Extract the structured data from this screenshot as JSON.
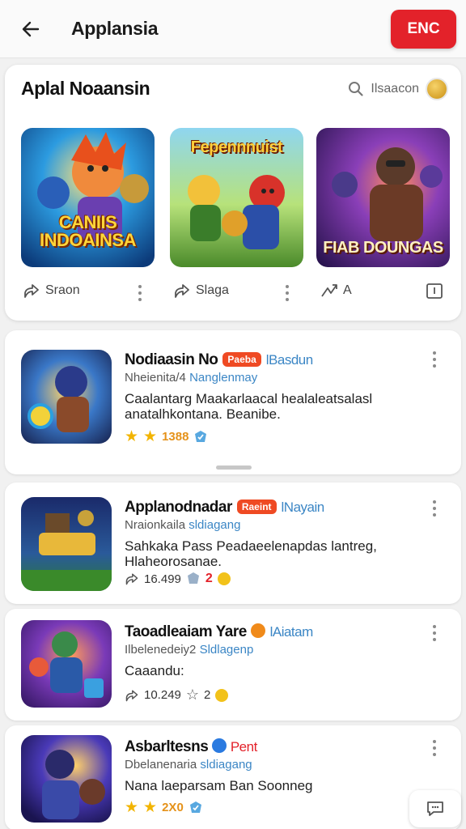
{
  "topbar": {
    "title": "Applansia",
    "action_label": "ENC"
  },
  "featured": {
    "title": "Aplal Noaansin",
    "search_text": "Ilsaacon",
    "tiles": [
      {
        "text": "CANIIS INDOAINSA"
      },
      {
        "text": "Fepennnuist"
      },
      {
        "text": "FIAB DOUNGAS"
      }
    ],
    "actions": [
      {
        "label": "Sraon"
      },
      {
        "label": "Slaga"
      },
      {
        "label": "A"
      }
    ]
  },
  "apps": [
    {
      "name": "Nodiaasin No",
      "badge": "Paeba",
      "tag": "lBasdun",
      "dev_prefix": "Nheienita/4",
      "dev_link": "Nanglenmay",
      "description": "Caalantarg Maakarlaacal healaleatsalasl anatalhkontana. Beanibe.",
      "rating": "1388"
    },
    {
      "name": "Applanodnadar",
      "badge": "Raeint",
      "tag": "lNayain",
      "dev_prefix": "Nraionkaila",
      "dev_link": "sldiagang",
      "description": "Sahkaka Pass Peadaeelenapdas lantreg, Hlaheorosanae.",
      "downloads": "16.499",
      "count": "2"
    },
    {
      "name": "Taoadleaiam Yare",
      "tag": "lAiatam",
      "dev_prefix": "Ilbelenedeiy2",
      "dev_link": "Sldlagenp",
      "description": "Caaandu:",
      "downloads": "10.249",
      "count": "2"
    },
    {
      "name": "Asbarltesns",
      "badge_text": "Pent",
      "dev_prefix": "Dbelanenaria",
      "dev_link": "sldiagang",
      "description": "Nana laeparsam Ban Soonneg",
      "rating": "2X0"
    }
  ],
  "colors": {
    "accent": "#e3222a",
    "link": "#3b86c5",
    "star": "#f2b400"
  },
  "icons": [
    "back-arrow-icon",
    "search-icon",
    "coin-icon",
    "share-icon",
    "more-vert-icon",
    "trend-icon",
    "bookmark-icon",
    "star-icon",
    "verified-icon",
    "emoji-icon",
    "chat-icon"
  ]
}
